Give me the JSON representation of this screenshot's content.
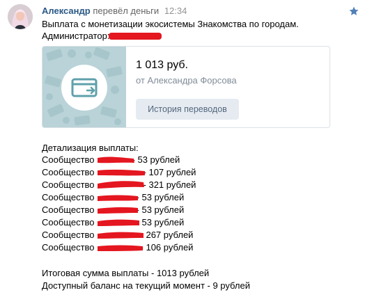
{
  "post": {
    "author_name": "Александр",
    "action": "перевёл деньги",
    "time": "12:34",
    "message_line1": "Выплата с монетизации экосистемы Знакомства по городам.",
    "admin_label": "Администратор:"
  },
  "transfer": {
    "amount": "1 013 руб.",
    "from": "от Александра Форсова",
    "history_button": "История переводов"
  },
  "details": {
    "heading": "Детализация выплаты:",
    "rows": [
      {
        "label": "Сообщество",
        "amount": "- 53 рублей"
      },
      {
        "label": "Сообщество",
        "amount": "- 107 рублей"
      },
      {
        "label": "Сообщество",
        "amount": "- 321 рублей"
      },
      {
        "label": "Сообщество",
        "amount": "- 53 рублей"
      },
      {
        "label": "Сообщество",
        "amount": "- 53 рублей"
      },
      {
        "label": "Сообщество",
        "amount": "- 53 рублей"
      },
      {
        "label": "Сообщество",
        "amount": "- 267 рублей"
      },
      {
        "label": "Сообщество",
        "amount": "- 106 рублей"
      }
    ],
    "total": "Итоговая сумма выплаты - 1013 рублей",
    "balance": "Доступный баланс на текущий момент - 9 рублей"
  },
  "icons": {
    "star": "star-icon",
    "card": "money-transfer-card-icon"
  },
  "colors": {
    "link": "#2a5885",
    "star": "#5181b8",
    "redaction": "#e4161f",
    "button_bg": "#e5ebf1",
    "card_bg": "#b9d3d8"
  }
}
